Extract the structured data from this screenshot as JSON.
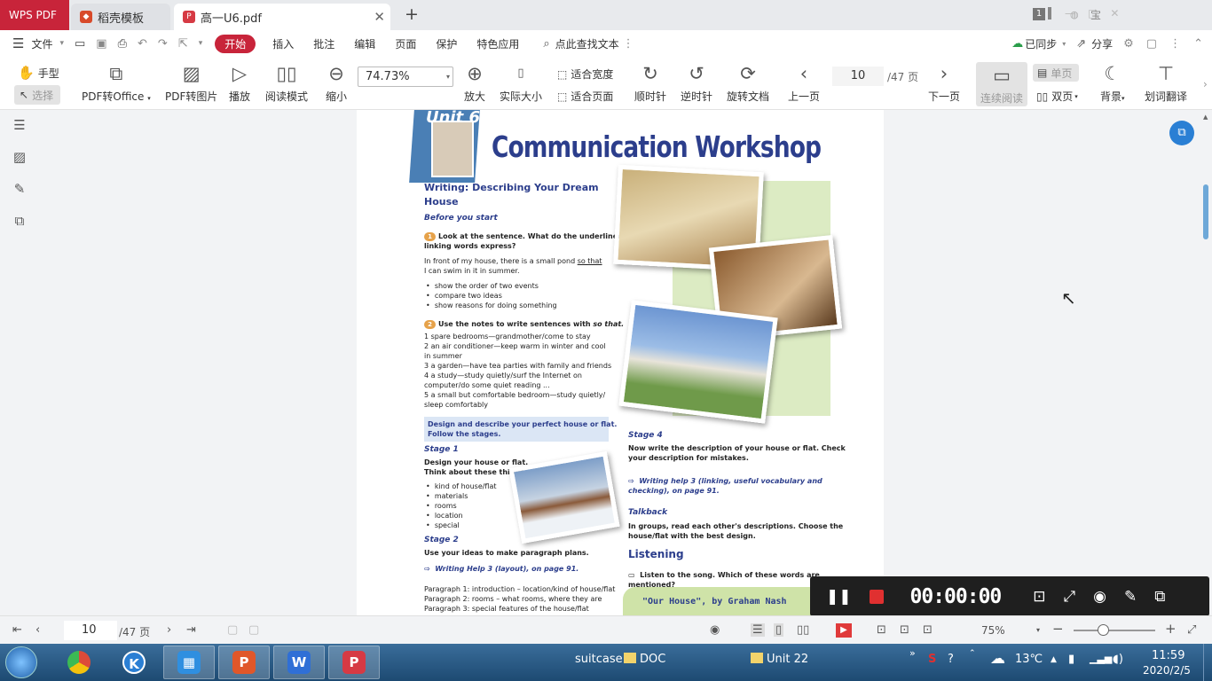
{
  "titlebar": {
    "app_name": "WPS PDF",
    "tabs": [
      {
        "label": "稻壳模板",
        "icon": "docer-icon"
      },
      {
        "label": "高一U6.pdf",
        "icon": "pdf-icon"
      }
    ],
    "window_badge": "1",
    "user_label": "宝"
  },
  "menubar": {
    "file": "文件",
    "items": [
      "开始",
      "插入",
      "批注",
      "编辑",
      "页面",
      "保护",
      "特色应用"
    ],
    "search": "点此查找文本",
    "sync": "已同步",
    "share": "分享"
  },
  "ribbon": {
    "hand": "手型",
    "select": "选择",
    "pdf_to_office": "PDF转Office",
    "pdf_to_image": "PDF转图片",
    "play": "播放",
    "read_mode": "阅读模式",
    "zoom_out": "缩小",
    "zoom_value": "74.73%",
    "zoom_in": "放大",
    "actual_size": "实际大小",
    "fit_width": "适合宽度",
    "fit_page": "适合页面",
    "rotate_cw": "顺时针",
    "rotate_ccw": "逆时针",
    "rotate_doc": "旋转文档",
    "prev_page": "上一页",
    "page_current": "10",
    "page_total": "/47 页",
    "next_page": "下一页",
    "continuous": "连续阅读",
    "single": "单页",
    "double": "双页",
    "background": "背景",
    "translate": "划词翻译"
  },
  "document": {
    "unit_label": "Unit 6",
    "title": "Communication Workshop",
    "writing_heading_1": "Writing: Describing Your Dream",
    "writing_heading_2": "House",
    "before_you_start": "Before you start",
    "q1_num": "1",
    "q1_line1": "Look at the sentence. What do the underlined",
    "q1_line2": "linking words express?",
    "example_pre": "In front of my house, there is a small pond ",
    "example_underlined": "so that",
    "example_line2": "I can swim in it in summer.",
    "bullets1": [
      "show the order of two events",
      "compare two ideas",
      "show reasons for doing something"
    ],
    "q2_num": "2",
    "q2_text": "Use the notes to write sentences with ",
    "q2_italic": "so that.",
    "notes": [
      "1  spare bedrooms—grandmother/come to stay",
      "2  an air conditioner—keep warm in winter and cool",
      "    in summer",
      "3  a garden—have tea parties with family and friends",
      "4  a study—study quietly/surf the Internet on",
      "    computer/do some quiet reading ...",
      "5  a small but comfortable bedroom—study quietly/",
      "    sleep comfortably"
    ],
    "design_box_1": "Design and describe your perfect house or flat.",
    "design_box_2": "Follow the stages.",
    "stage1": "Stage 1",
    "stage1_line1": "Design your house or flat.",
    "stage1_line2": "Think about these things:",
    "stage1_bullets": [
      "kind of house/flat",
      "materials",
      "rooms",
      "location",
      "special"
    ],
    "stage2": "Stage 2",
    "stage2_text": "Use your ideas to make paragraph plans.",
    "writing_help_1": "Writing Help 3 (layout), on page 91.",
    "paragraphs": [
      "Paragraph 1: introduction – location/kind of house/flat",
      "Paragraph 2: rooms – what rooms, where they are",
      "Paragraph 3: special features of the house/flat"
    ],
    "stage4": "Stage 4",
    "stage4_line1": "Now write the description of your house or flat. Check",
    "stage4_line2": "your description for mistakes.",
    "writing_help_2a": "Writing help 3 (linking, useful vocabulary and",
    "writing_help_2b": "checking), on page 91.",
    "talkback": "Talkback",
    "talkback_line1": "In groups, read each other's descriptions. Choose the",
    "talkback_line2": "house/flat with the best design.",
    "listening": "Listening",
    "listening_line1": "Listen to the song. Which of these words are",
    "listening_line2": "mentioned?",
    "song": "\"Our House\", by Graham Nash"
  },
  "recorder": {
    "time": "00:00:00"
  },
  "statusbar": {
    "page_current": "10",
    "page_total": "/47 页",
    "zoom": "75%"
  },
  "taskbar": {
    "apps": [
      {
        "name": "chrome",
        "glyph": "",
        "color": "#dd4b39"
      },
      {
        "name": "k-app",
        "glyph": "K",
        "color": "#2a7fd4"
      },
      {
        "name": "settings",
        "glyph": "▦",
        "color": "#2f8fe0"
      },
      {
        "name": "wps-presentation",
        "glyph": "P",
        "color": "#e0572a"
      },
      {
        "name": "wps-writer",
        "glyph": "W",
        "color": "#2f6fd6"
      },
      {
        "name": "wps-pdf",
        "glyph": "P",
        "color": "#d63a44"
      }
    ],
    "suitcase": "suitcase",
    "folder1": "DOC",
    "folder2": "Unit 22",
    "temperature": "13℃",
    "time": "11:59",
    "date": "2020/2/5"
  },
  "colors": {
    "accent": "#c8243a",
    "taskbar": "#245482",
    "doc_blue": "#2c3e8c"
  }
}
